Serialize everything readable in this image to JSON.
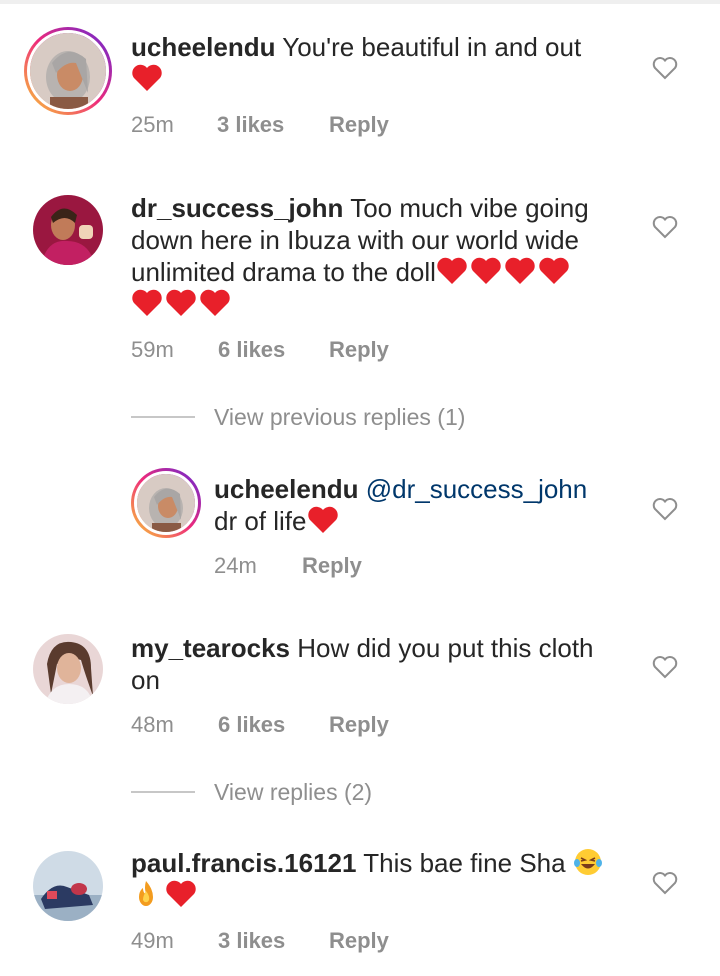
{
  "comments": [
    {
      "username": "ucheelendu",
      "text": "You're beautiful in and out",
      "emoji_hearts": 1,
      "time": "25m",
      "likes": "3 likes",
      "reply": "Reply"
    },
    {
      "username": "dr_success_john",
      "text_line1": "Too much vibe going",
      "text_line2": "down here in Ibuza with our world wide",
      "text_line3": "unlimited drama to the doll",
      "emoji_hearts_line3": 4,
      "emoji_hearts_line4": 3,
      "time": "59m",
      "likes": "6 likes",
      "reply": "Reply",
      "view_previous": "View previous replies (1)"
    },
    {
      "username": "ucheelendu",
      "mention": "@dr_success_john",
      "text": "dr of life",
      "time": "24m",
      "reply": "Reply"
    },
    {
      "username": "my_tearocks",
      "text_line1": "How did you put this cloth",
      "text_line2": "on",
      "time": "48m",
      "likes": "6 likes",
      "reply": "Reply",
      "view_replies": "View replies (2)"
    },
    {
      "username": "paul.francis.16121",
      "text": "This bae fine Sha",
      "time": "49m",
      "likes": "3 likes",
      "reply": "Reply"
    }
  ],
  "colors": {
    "heart_red": "#e8202a",
    "meta_gray": "#8e8e8e",
    "mention_blue": "#00376b",
    "story_ring": "#ee2a7b"
  }
}
